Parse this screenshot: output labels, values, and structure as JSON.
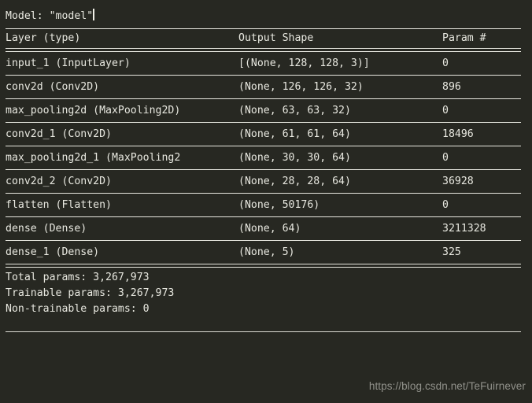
{
  "terminal": {
    "title": "Model: \"model\"",
    "background_color": "#272822",
    "text_color": "#e8e8e0"
  },
  "table": {
    "headers": {
      "layer": "Layer (type)",
      "shape": "Output Shape",
      "param": "Param #"
    },
    "rows": [
      {
        "layer": "input_1 (InputLayer)",
        "shape": "[(None, 128, 128, 3)]",
        "param": "0"
      },
      {
        "layer": "conv2d (Conv2D)",
        "shape": "(None, 126, 126, 32)",
        "param": "896"
      },
      {
        "layer": "max_pooling2d (MaxPooling2D)",
        "shape": "(None, 63, 63, 32)",
        "param": "0"
      },
      {
        "layer": "conv2d_1 (Conv2D)",
        "shape": "(None, 61, 61, 64)",
        "param": "18496"
      },
      {
        "layer": "max_pooling2d_1 (MaxPooling2",
        "shape": "(None, 30, 30, 64)",
        "param": "0"
      },
      {
        "layer": "conv2d_2 (Conv2D)",
        "shape": "(None, 28, 28, 64)",
        "param": "36928"
      },
      {
        "layer": "flatten (Flatten)",
        "shape": "(None, 50176)",
        "param": "0"
      },
      {
        "layer": "dense (Dense)",
        "shape": "(None, 64)",
        "param": "3211328"
      },
      {
        "layer": "dense_1 (Dense)",
        "shape": "(None, 5)",
        "param": "325"
      }
    ]
  },
  "totals": {
    "total_params": "Total params: 3,267,973",
    "trainable_params": "Trainable params: 3,267,973",
    "non_trainable_params": "Non-trainable params: 0"
  },
  "watermark": {
    "text": "https://blog.csdn.net/TeFuirnever"
  }
}
